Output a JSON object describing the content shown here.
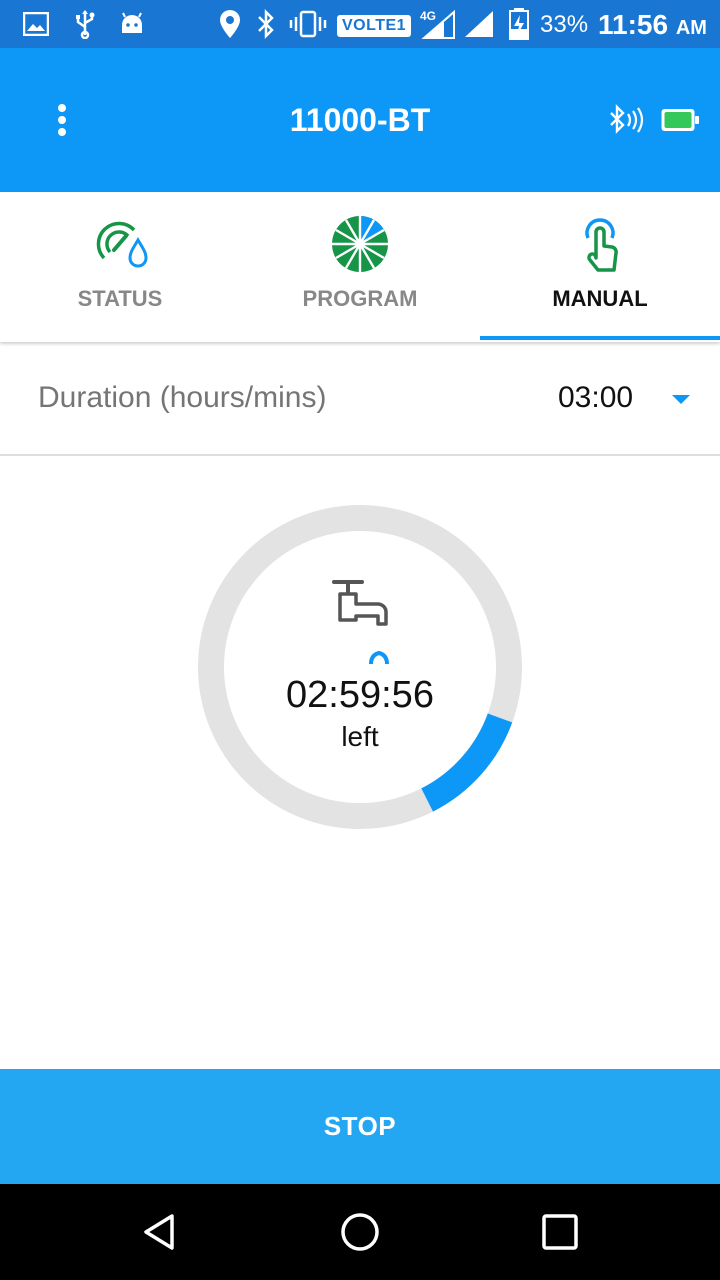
{
  "status_bar": {
    "volte": "VOLTE1",
    "network": "4G",
    "battery_percent": "33%",
    "time": "11:56",
    "ampm": "AM",
    "background_color": "#1976d2",
    "icons": [
      "image-icon",
      "usb-icon",
      "android-icon",
      "location-icon",
      "bluetooth-icon",
      "vibrate-icon",
      "signal-icon",
      "signal-icon",
      "battery-charging-icon"
    ]
  },
  "app_bar": {
    "title": "11000-BT",
    "background_color": "#0d97f7",
    "icons": [
      "more-vert-icon",
      "bluetooth-connected-icon",
      "battery-full-icon"
    ]
  },
  "tabs": [
    {
      "label": "STATUS",
      "icon": "gauge-drop-icon",
      "active": false
    },
    {
      "label": "PROGRAM",
      "icon": "sprinkler-wheel-icon",
      "active": false
    },
    {
      "label": "MANUAL",
      "icon": "touch-hand-icon",
      "active": true
    }
  ],
  "duration": {
    "label": "Duration (hours/mins)",
    "value": "03:00",
    "options_icon": "dropdown-caret-icon"
  },
  "timer": {
    "time_left": "02:59:56",
    "suffix": "left",
    "progress_fraction": 0.12,
    "progress_color": "#0d97f7",
    "track_color": "#e3e3e3",
    "icons": [
      "water-tap-icon",
      "water-drop-icon"
    ]
  },
  "actions": {
    "stop_label": "STOP",
    "stop_color": "#23a7f2"
  },
  "nav_bar": {
    "icons": [
      "back-icon",
      "home-icon",
      "recents-icon"
    ]
  },
  "colors": {
    "icon_green": "#169447"
  }
}
